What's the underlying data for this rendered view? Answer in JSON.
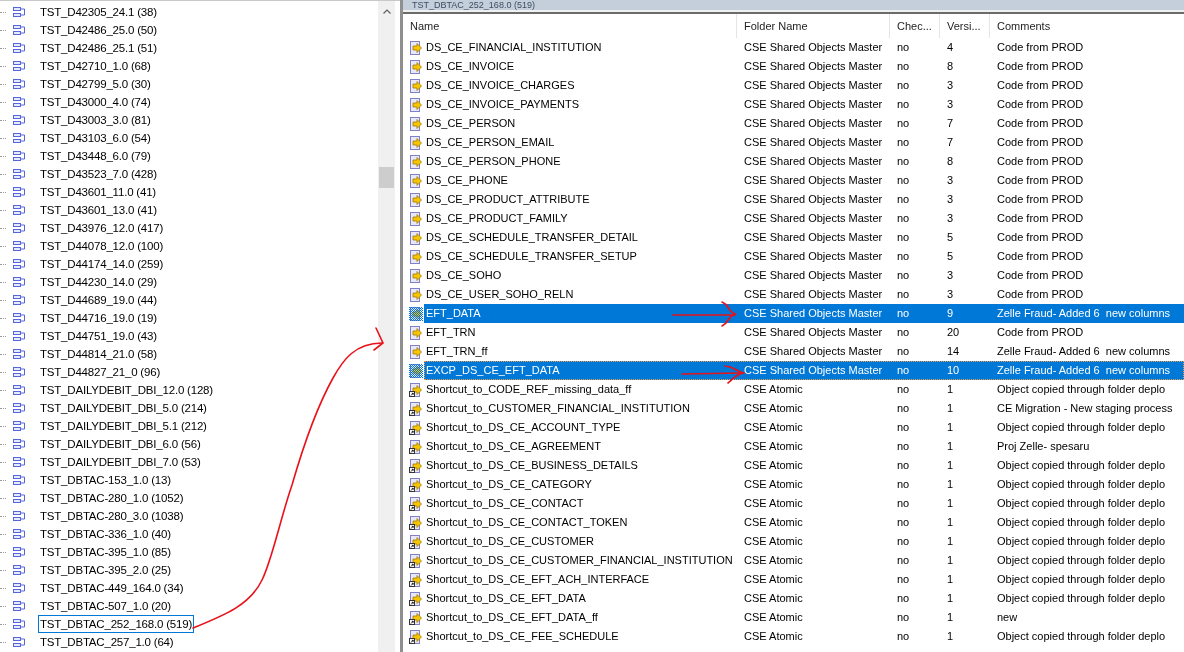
{
  "tree": {
    "items": [
      {
        "label": "TST_D42305_24.1 (38)",
        "selected": false
      },
      {
        "label": "TST_D42486_25.0 (50)",
        "selected": false
      },
      {
        "label": "TST_D42486_25.1 (51)",
        "selected": false
      },
      {
        "label": "TST_D42710_1.0 (68)",
        "selected": false
      },
      {
        "label": "TST_D42799_5.0 (30)",
        "selected": false
      },
      {
        "label": "TST_D43000_4.0 (74)",
        "selected": false
      },
      {
        "label": "TST_D43003_3.0 (81)",
        "selected": false
      },
      {
        "label": "TST_D43103_6.0 (54)",
        "selected": false
      },
      {
        "label": "TST_D43448_6.0 (79)",
        "selected": false
      },
      {
        "label": "TST_D43523_7.0 (428)",
        "selected": false
      },
      {
        "label": "TST_D43601_11.0 (41)",
        "selected": false
      },
      {
        "label": "TST_D43601_13.0 (41)",
        "selected": false
      },
      {
        "label": "TST_D43976_12.0 (417)",
        "selected": false
      },
      {
        "label": "TST_D44078_12.0 (100)",
        "selected": false
      },
      {
        "label": "TST_D44174_14.0 (259)",
        "selected": false
      },
      {
        "label": "TST_D44230_14.0 (29)",
        "selected": false
      },
      {
        "label": "TST_D44689_19.0 (44)",
        "selected": false
      },
      {
        "label": "TST_D44716_19.0 (19)",
        "selected": false
      },
      {
        "label": "TST_D44751_19.0 (43)",
        "selected": false
      },
      {
        "label": "TST_D44814_21.0 (58)",
        "selected": false
      },
      {
        "label": "TST_D44827_21_0 (96)",
        "selected": false
      },
      {
        "label": "TST_DAILYDEBIT_DBI_12.0 (128)",
        "selected": false
      },
      {
        "label": "TST_DAILYDEBIT_DBI_5.0 (214)",
        "selected": false
      },
      {
        "label": "TST_DAILYDEBIT_DBI_5.1 (212)",
        "selected": false
      },
      {
        "label": "TST_DAILYDEBIT_DBI_6.0 (56)",
        "selected": false
      },
      {
        "label": "TST_DAILYDEBIT_DBI_7.0 (53)",
        "selected": false
      },
      {
        "label": "TST_DBTAC-153_1.0 (13)",
        "selected": false
      },
      {
        "label": "TST_DBTAC-280_1.0 (1052)",
        "selected": false
      },
      {
        "label": "TST_DBTAC-280_3.0 (1038)",
        "selected": false
      },
      {
        "label": "TST_DBTAC-336_1.0 (40)",
        "selected": false
      },
      {
        "label": "TST_DBTAC-395_1.0 (85)",
        "selected": false
      },
      {
        "label": "TST_DBTAC-395_2.0 (25)",
        "selected": false
      },
      {
        "label": "TST_DBTAC-449_164.0 (34)",
        "selected": false
      },
      {
        "label": "TST_DBTAC-507_1.0 (20)",
        "selected": false
      },
      {
        "label": "TST_DBTAC_252_168.0 (519)",
        "selected": true
      },
      {
        "label": "TST_DBTAC_257_1.0 (64)",
        "selected": false
      }
    ]
  },
  "folder_view": {
    "title": "TST_DBTAC_252_168.0 (519)",
    "columns": [
      "Name",
      "Folder Name",
      "Chec...",
      "Versi...",
      "Comments"
    ],
    "rows": [
      {
        "kind": "source",
        "name": "DS_CE_FINANCIAL_INSTITUTION",
        "folder_name": "CSE Shared Objects Master",
        "column_3": "no",
        "column_4": "4",
        "comments": "Code from PROD",
        "selected": false,
        "focused": false
      },
      {
        "kind": "source",
        "name": "DS_CE_INVOICE",
        "folder_name": "CSE Shared Objects Master",
        "column_3": "no",
        "column_4": "8",
        "comments": "Code from PROD",
        "selected": false,
        "focused": false
      },
      {
        "kind": "source",
        "name": "DS_CE_INVOICE_CHARGES",
        "folder_name": "CSE Shared Objects Master",
        "column_3": "no",
        "column_4": "3",
        "comments": "Code from PROD",
        "selected": false,
        "focused": false
      },
      {
        "kind": "source",
        "name": "DS_CE_INVOICE_PAYMENTS",
        "folder_name": "CSE Shared Objects Master",
        "column_3": "no",
        "column_4": "3",
        "comments": "Code from PROD",
        "selected": false,
        "focused": false
      },
      {
        "kind": "source",
        "name": "DS_CE_PERSON",
        "folder_name": "CSE Shared Objects Master",
        "column_3": "no",
        "column_4": "7",
        "comments": "Code from PROD",
        "selected": false,
        "focused": false
      },
      {
        "kind": "source",
        "name": "DS_CE_PERSON_EMAIL",
        "folder_name": "CSE Shared Objects Master",
        "column_3": "no",
        "column_4": "7",
        "comments": "Code from PROD",
        "selected": false,
        "focused": false
      },
      {
        "kind": "source",
        "name": "DS_CE_PERSON_PHONE",
        "folder_name": "CSE Shared Objects Master",
        "column_3": "no",
        "column_4": "8",
        "comments": "Code from PROD",
        "selected": false,
        "focused": false
      },
      {
        "kind": "source",
        "name": "DS_CE_PHONE",
        "folder_name": "CSE Shared Objects Master",
        "column_3": "no",
        "column_4": "3",
        "comments": "Code from PROD",
        "selected": false,
        "focused": false
      },
      {
        "kind": "source",
        "name": "DS_CE_PRODUCT_ATTRIBUTE",
        "folder_name": "CSE Shared Objects Master",
        "column_3": "no",
        "column_4": "3",
        "comments": "Code from PROD",
        "selected": false,
        "focused": false
      },
      {
        "kind": "source",
        "name": "DS_CE_PRODUCT_FAMILY",
        "folder_name": "CSE Shared Objects Master",
        "column_3": "no",
        "column_4": "3",
        "comments": "Code from PROD",
        "selected": false,
        "focused": false
      },
      {
        "kind": "source",
        "name": "DS_CE_SCHEDULE_TRANSFER_DETAIL",
        "folder_name": "CSE Shared Objects Master",
        "column_3": "no",
        "column_4": "5",
        "comments": "Code from PROD",
        "selected": false,
        "focused": false
      },
      {
        "kind": "source",
        "name": "DS_CE_SCHEDULE_TRANSFER_SETUP",
        "folder_name": "CSE Shared Objects Master",
        "column_3": "no",
        "column_4": "5",
        "comments": "Code from PROD",
        "selected": false,
        "focused": false
      },
      {
        "kind": "source",
        "name": "DS_CE_SOHO",
        "folder_name": "CSE Shared Objects Master",
        "column_3": "no",
        "column_4": "3",
        "comments": "Code from PROD",
        "selected": false,
        "focused": false
      },
      {
        "kind": "source",
        "name": "DS_CE_USER_SOHO_RELN",
        "folder_name": "CSE Shared Objects Master",
        "column_3": "no",
        "column_4": "3",
        "comments": "Code from PROD",
        "selected": false,
        "focused": false
      },
      {
        "kind": "source",
        "name": "EFT_DATA",
        "folder_name": "CSE Shared Objects Master",
        "column_3": "no",
        "column_4": "9",
        "comments": "Zelle Fraud- Added 6  new columns",
        "selected": true,
        "focused": false
      },
      {
        "kind": "source",
        "name": "EFT_TRN",
        "folder_name": "CSE Shared Objects Master",
        "column_3": "no",
        "column_4": "20",
        "comments": "Code from PROD",
        "selected": false,
        "focused": false
      },
      {
        "kind": "source",
        "name": "EFT_TRN_ff",
        "folder_name": "CSE Shared Objects Master",
        "column_3": "no",
        "column_4": "14",
        "comments": "Zelle Fraud- Added 6  new columns",
        "selected": false,
        "focused": false
      },
      {
        "kind": "source",
        "name": "EXCP_DS_CE_EFT_DATA",
        "folder_name": "CSE Shared Objects Master",
        "column_3": "no",
        "column_4": "10",
        "comments": "Zelle Fraud- Added 6  new columns",
        "selected": true,
        "focused": true
      },
      {
        "kind": "shortcut",
        "name": "Shortcut_to_CODE_REF_missing_data_ff",
        "folder_name": "CSE Atomic",
        "column_3": "no",
        "column_4": "1",
        "comments": "Object copied through folder deplo",
        "selected": false,
        "focused": false
      },
      {
        "kind": "shortcut",
        "name": "Shortcut_to_CUSTOMER_FINANCIAL_INSTITUTION",
        "folder_name": "CSE Atomic",
        "column_3": "no",
        "column_4": "1",
        "comments": "CE Migration - New staging process",
        "selected": false,
        "focused": false
      },
      {
        "kind": "shortcut",
        "name": "Shortcut_to_DS_CE_ACCOUNT_TYPE",
        "folder_name": "CSE Atomic",
        "column_3": "no",
        "column_4": "1",
        "comments": "Object copied through folder deplo",
        "selected": false,
        "focused": false
      },
      {
        "kind": "shortcut",
        "name": "Shortcut_to_DS_CE_AGREEMENT",
        "folder_name": "CSE Atomic",
        "column_3": "no",
        "column_4": "1",
        "comments": "Proj Zelle- spesaru",
        "selected": false,
        "focused": false
      },
      {
        "kind": "shortcut",
        "name": "Shortcut_to_DS_CE_BUSINESS_DETAILS",
        "folder_name": "CSE Atomic",
        "column_3": "no",
        "column_4": "1",
        "comments": "Object copied through folder deplo",
        "selected": false,
        "focused": false
      },
      {
        "kind": "shortcut",
        "name": "Shortcut_to_DS_CE_CATEGORY",
        "folder_name": "CSE Atomic",
        "column_3": "no",
        "column_4": "1",
        "comments": "Object copied through folder deplo",
        "selected": false,
        "focused": false
      },
      {
        "kind": "shortcut",
        "name": "Shortcut_to_DS_CE_CONTACT",
        "folder_name": "CSE Atomic",
        "column_3": "no",
        "column_4": "1",
        "comments": "Object copied through folder deplo",
        "selected": false,
        "focused": false
      },
      {
        "kind": "shortcut",
        "name": "Shortcut_to_DS_CE_CONTACT_TOKEN",
        "folder_name": "CSE Atomic",
        "column_3": "no",
        "column_4": "1",
        "comments": "Object copied through folder deplo",
        "selected": false,
        "focused": false
      },
      {
        "kind": "shortcut",
        "name": "Shortcut_to_DS_CE_CUSTOMER",
        "folder_name": "CSE Atomic",
        "column_3": "no",
        "column_4": "1",
        "comments": "Object copied through folder deplo",
        "selected": false,
        "focused": false
      },
      {
        "kind": "shortcut",
        "name": "Shortcut_to_DS_CE_CUSTOMER_FINANCIAL_INSTITUTION",
        "folder_name": "CSE Atomic",
        "column_3": "no",
        "column_4": "1",
        "comments": "Object copied through folder deplo",
        "selected": false,
        "focused": false
      },
      {
        "kind": "shortcut",
        "name": "Shortcut_to_DS_CE_EFT_ACH_INTERFACE",
        "folder_name": "CSE Atomic",
        "column_3": "no",
        "column_4": "1",
        "comments": "Object copied through folder deplo",
        "selected": false,
        "focused": false
      },
      {
        "kind": "shortcut",
        "name": "Shortcut_to_DS_CE_EFT_DATA",
        "folder_name": "CSE Atomic",
        "column_3": "no",
        "column_4": "1",
        "comments": "Object copied through folder deplo",
        "selected": false,
        "focused": false
      },
      {
        "kind": "shortcut",
        "name": "Shortcut_to_DS_CE_EFT_DATA_ff",
        "folder_name": "CSE Atomic",
        "column_3": "no",
        "column_4": "1",
        "comments": "new",
        "selected": false,
        "focused": false
      },
      {
        "kind": "shortcut",
        "name": "Shortcut_to_DS_CE_FEE_SCHEDULE",
        "folder_name": "CSE Atomic",
        "column_3": "no",
        "column_4": "1",
        "comments": "Object copied through folder deplo",
        "selected": false,
        "focused": false
      }
    ]
  }
}
